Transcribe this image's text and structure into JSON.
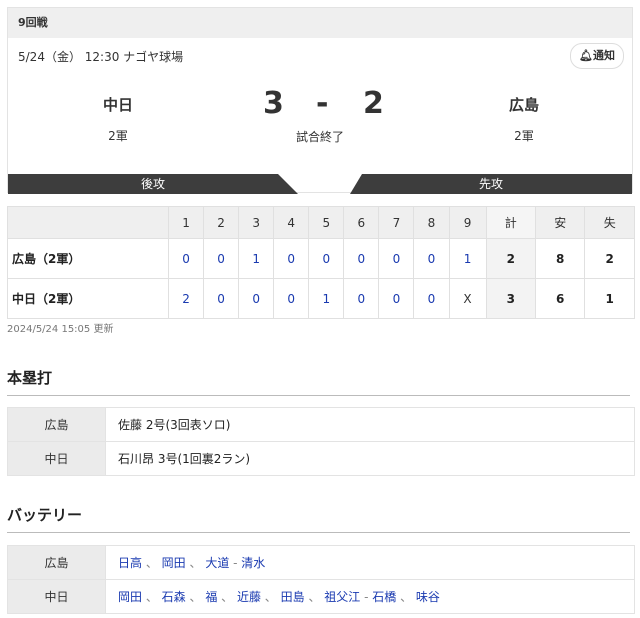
{
  "game": {
    "round": "9回戦",
    "meta": "5/24（金） 12:30 ナゴヤ球場",
    "notify": "通知",
    "home": {
      "name": "中日",
      "div": "2軍",
      "score": "3",
      "side": "後攻"
    },
    "away": {
      "name": "広島",
      "div": "2軍",
      "score": "2",
      "side": "先攻"
    },
    "dash": "-",
    "status": "試合終了"
  },
  "linescore": {
    "headers": [
      "1",
      "2",
      "3",
      "4",
      "5",
      "6",
      "7",
      "8",
      "9",
      "計",
      "安",
      "失"
    ],
    "rows": [
      {
        "team": "広島（2軍）",
        "innings": [
          "0",
          "0",
          "1",
          "0",
          "0",
          "0",
          "0",
          "0",
          "1"
        ],
        "R": "2",
        "H": "8",
        "E": "2"
      },
      {
        "team": "中日（2軍）",
        "innings": [
          "2",
          "0",
          "0",
          "0",
          "1",
          "0",
          "0",
          "0",
          "X"
        ],
        "R": "3",
        "H": "6",
        "E": "1"
      }
    ]
  },
  "updated": "2024/5/24 15:05 更新",
  "homeruns": {
    "title": "本塁打",
    "rows": [
      {
        "team": "広島",
        "text": "佐藤  2号(3回表ソロ)"
      },
      {
        "team": "中日",
        "text": "石川昂  3号(1回裏2ラン)"
      }
    ]
  },
  "battery": {
    "title": "バッテリー",
    "rows": [
      {
        "team": "広島",
        "pitchers": [
          "日高",
          "岡田",
          "大道"
        ],
        "catchers": [
          "清水"
        ]
      },
      {
        "team": "中日",
        "pitchers": [
          "岡田",
          "石森",
          "福",
          "近藤",
          "田島",
          "祖父江"
        ],
        "catchers": [
          "石橋",
          "味谷"
        ]
      }
    ]
  }
}
